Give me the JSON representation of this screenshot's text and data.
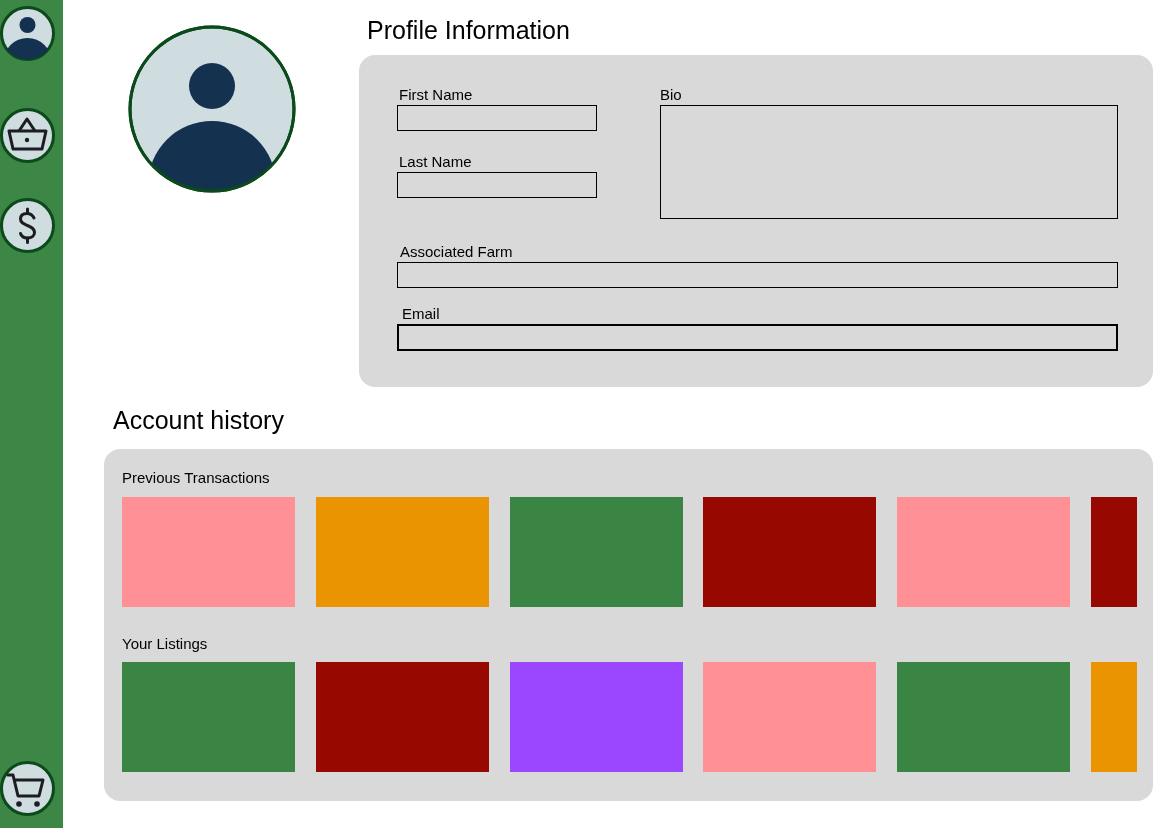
{
  "profile": {
    "title": "Profile Information",
    "name_fields": [
      {
        "label": "First Name"
      },
      {
        "label": "Last Name"
      }
    ],
    "bio": {
      "label": "Bio"
    },
    "wide_fields": [
      {
        "label": "Associated Farm"
      },
      {
        "label": "Email"
      }
    ]
  },
  "account_history": {
    "title": "Account history",
    "sections": [
      {
        "title": "Previous Transactions",
        "items": [
          {
            "color": "#ff9096"
          },
          {
            "color": "#eb9402"
          },
          {
            "color": "#3b8544"
          },
          {
            "color": "#960800"
          },
          {
            "color": "#ff9096"
          },
          {
            "color": "#960800"
          }
        ]
      },
      {
        "title": "Your Listings",
        "items": [
          {
            "color": "#3b8544"
          },
          {
            "color": "#960800"
          },
          {
            "color": "#9a47ff"
          },
          {
            "color": "#ff9096"
          },
          {
            "color": "#3b8544"
          },
          {
            "color": "#eb9402"
          }
        ]
      }
    ]
  }
}
